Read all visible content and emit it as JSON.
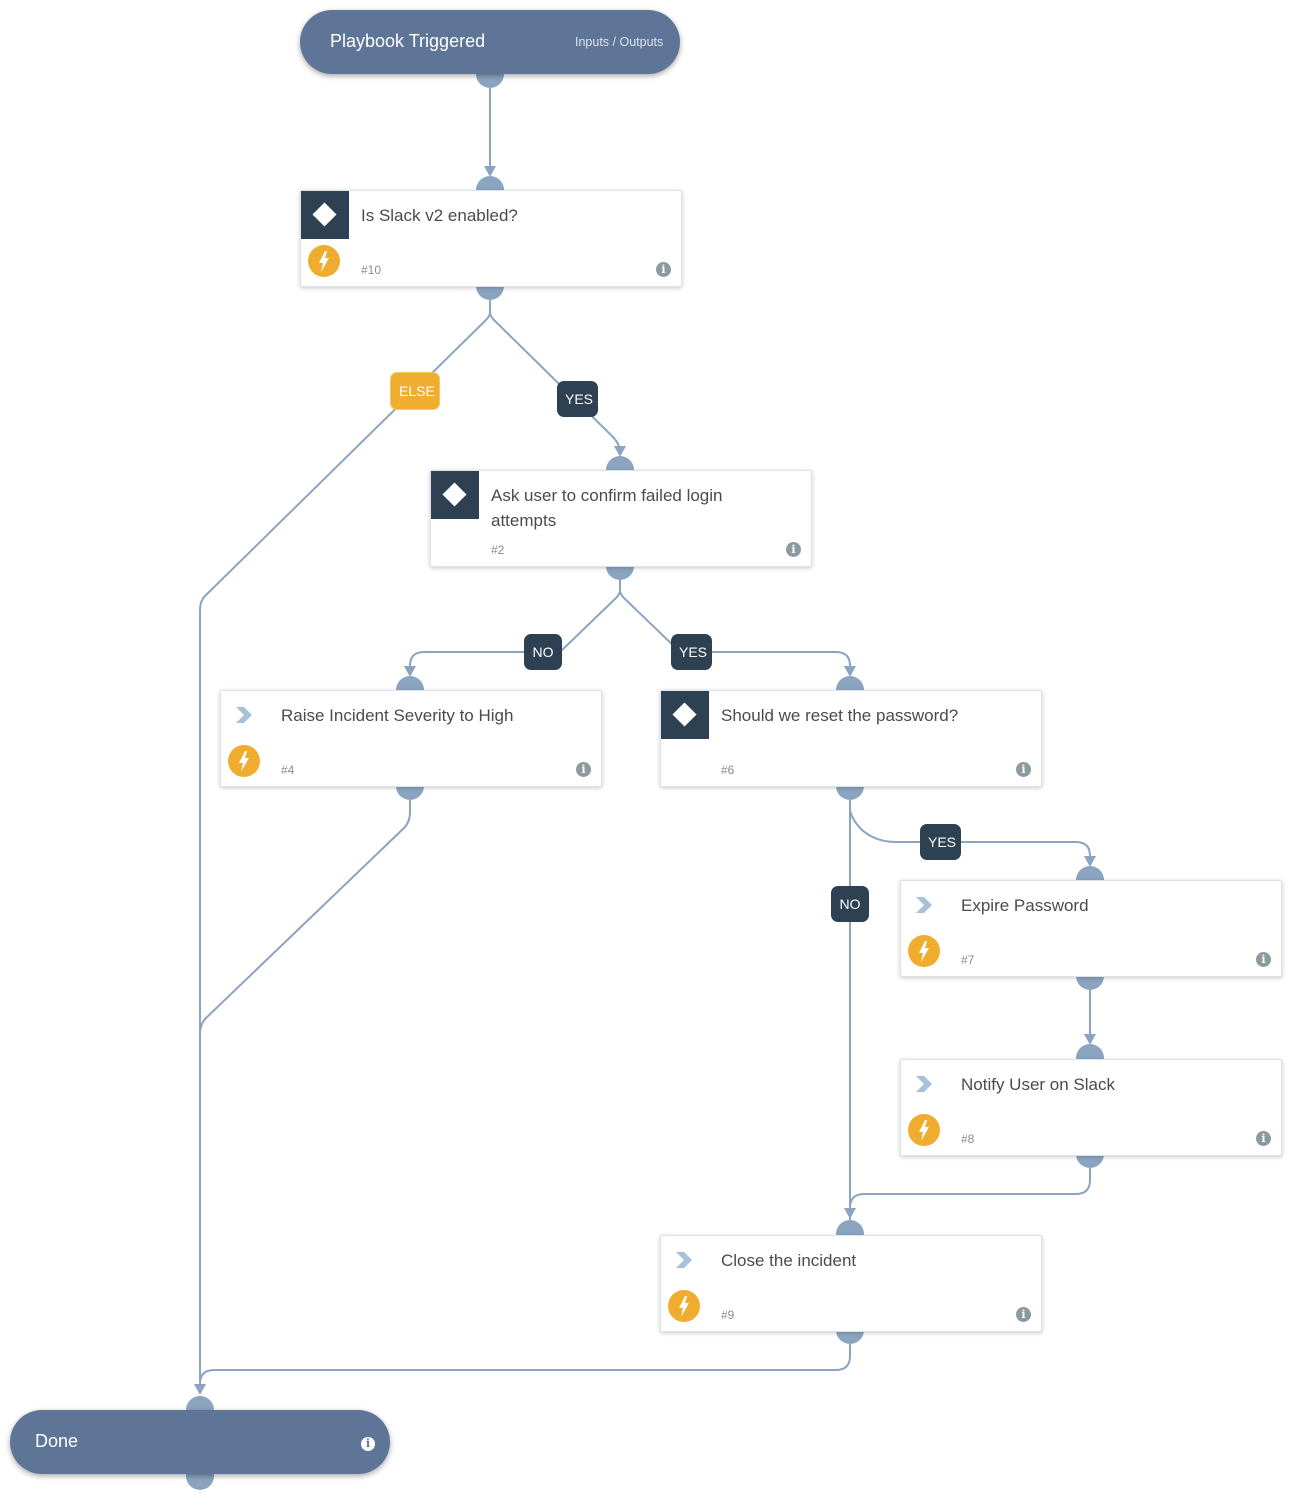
{
  "colors": {
    "pill": "#5f7597",
    "edge": "#8ba5c1",
    "condition_box": "#2e4152",
    "automation_badge": "#f0ac2f",
    "else_label": "#f0ae30",
    "yes_no_label": "#2e4152"
  },
  "start": {
    "title": "Playbook Triggered",
    "io_link": "Inputs / Outputs"
  },
  "end": {
    "title": "Done",
    "info_icon": "info-icon"
  },
  "tasks": [
    {
      "id": "10",
      "type": "condition",
      "name": "Is Slack v2 enabled?",
      "number": "#10",
      "automated": true
    },
    {
      "id": "2",
      "type": "condition",
      "name": "Ask user to confirm failed login attempts",
      "number": "#2",
      "automated": false
    },
    {
      "id": "4",
      "type": "action",
      "name": "Raise Incident Severity to High",
      "number": "#4",
      "automated": true
    },
    {
      "id": "6",
      "type": "condition",
      "name": "Should we reset the password?",
      "number": "#6",
      "automated": false
    },
    {
      "id": "7",
      "type": "action",
      "name": "Expire Password",
      "number": "#7",
      "automated": true
    },
    {
      "id": "8",
      "type": "action",
      "name": "Notify User on Slack",
      "number": "#8",
      "automated": true
    },
    {
      "id": "9",
      "type": "action",
      "name": "Close the incident",
      "number": "#9",
      "automated": true
    }
  ],
  "branch_labels": {
    "t10_else": "ELSE",
    "t10_yes": "YES",
    "t2_no": "NO",
    "t2_yes": "YES",
    "t6_yes": "YES",
    "t6_no": "NO"
  },
  "info_symbol": "i",
  "edges": [
    {
      "from": "start",
      "to": "10"
    },
    {
      "from": "10",
      "to": "done",
      "label": "ELSE"
    },
    {
      "from": "10",
      "to": "2",
      "label": "YES"
    },
    {
      "from": "2",
      "to": "4",
      "label": "NO"
    },
    {
      "from": "2",
      "to": "6",
      "label": "YES"
    },
    {
      "from": "4",
      "to": "done"
    },
    {
      "from": "6",
      "to": "7",
      "label": "YES"
    },
    {
      "from": "6",
      "to": "9",
      "label": "NO"
    },
    {
      "from": "7",
      "to": "8"
    },
    {
      "from": "8",
      "to": "9"
    },
    {
      "from": "9",
      "to": "done"
    }
  ]
}
